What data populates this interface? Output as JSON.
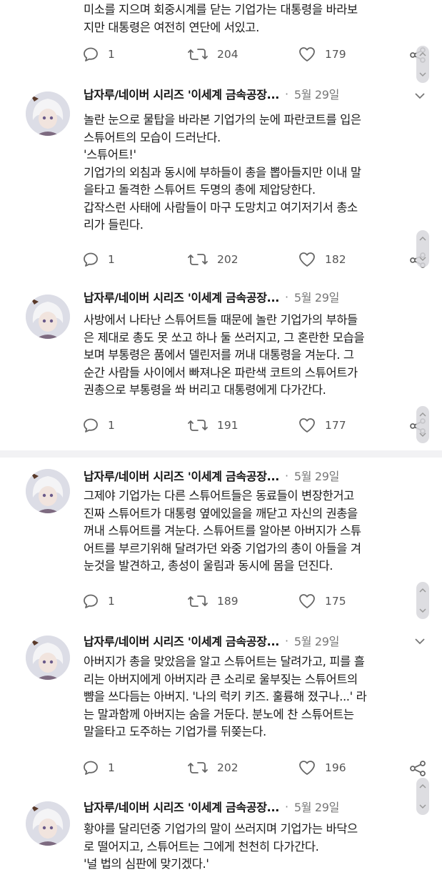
{
  "top_tweet": {
    "lines": [
      "미소를 지으며 회중시계를 닫는 기업가는 대통령을 바라보",
      "지만 대통령은 여전히 연단에 서있고."
    ],
    "replies": "1",
    "retweets": "204",
    "likes": "179"
  },
  "tweets": [
    {
      "author": "납자루/네이버 시리즈 '이세계 금속공장...",
      "date": "5월 29일",
      "lines": [
        "놀란 눈으로 물탑을 바라본 기업가의 눈에 파란코트를 입은",
        "스튜어트의 모습이 드러난다.",
        "'스튜어트!'",
        "기업가의 외침과 동시에 부하들이 총을 뽑아들지만 이내 말",
        "을타고 돌격한 스튜어트 두명의 총에 제압당한다.",
        "갑작스런 사태에 사람들이 마구 도망치고 여기저기서 총소",
        "리가 들린다."
      ],
      "replies": "1",
      "retweets": "202",
      "likes": "182"
    },
    {
      "author": "납자루/네이버 시리즈 '이세계 금속공장...",
      "date": "5월 29일",
      "lines": [
        "사방에서 나타난 스튜어트들 때문에 놀란 기업가의 부하들",
        "은 제대로 총도 못 쏘고 하나 둘 쓰러지고, 그 혼란한 모습을",
        "보며 부통령은 품에서 델린저를 꺼내 대통령을 겨눈다. 그",
        "순간 사람들 사이에서 빠져나온 파란색 코트의 스튜어트가",
        "권총으로 부통령을 쏴 버리고 대통령에게 다가간다."
      ],
      "replies": "1",
      "retweets": "191",
      "likes": "177"
    },
    {
      "author": "납자루/네이버 시리즈 '이세계 금속공장...",
      "date": "5월 29일",
      "lines": [
        "그제야 기업가는 다른 스튜어트들은 동료들이 변장한거고",
        "진짜 스튜어트가 대통령 옆에있을을 깨닫고 자신의 권총을",
        "꺼내 스튜어트를 겨눈다. 스튜어트를 알아본 아버지가 스튜",
        "어트를 부르기위해 달려가던 와중 기업가의 총이 아들을 겨",
        "눈것을 발견하고, 총성이 울림과 동시에 몸을 던진다."
      ],
      "replies": "1",
      "retweets": "189",
      "likes": "175"
    },
    {
      "author": "납자루/네이버 시리즈 '이세계 금속공장...",
      "date": "5월 29일",
      "lines": [
        "아버지가 총을 맞았음을 알고 스튜어트는 달려가고, 피를 흘",
        "리는 아버지에게 아버지라 큰 소리로 울부짖는 스튜어트의",
        "뺨을 쓰다듬는 아버지. '나의 럭키 키즈. 훌륭해 졌구나...' 라",
        "는 말과함께 아버지는 숨을 거둔다. 분노에 찬 스튜어트는",
        "말을타고 도주하는 기업가를 뒤쫒는다."
      ],
      "replies": "1",
      "retweets": "202",
      "likes": "196"
    },
    {
      "author": "납자루/네이버 시리즈 '이세계 금속공장...",
      "date": "5월 29일",
      "lines": [
        "황야를 달리던중 기업가의 말이 쓰러지며 기업가는 바닥으",
        "로 떨어지고, 스튜어트는 그에게 천천히 다가간다.",
        "'널 법의 심판에 맞기겠다.'"
      ],
      "replies": "",
      "retweets": "",
      "likes": ""
    }
  ],
  "colors": {
    "text": "#1a1a1a",
    "muted": "#555555",
    "date": "#777777",
    "divider": "#f2f2f4"
  },
  "icons": [
    "reply-icon",
    "retweet-icon",
    "like-icon",
    "share-icon",
    "chevron-down-icon",
    "avatar"
  ]
}
